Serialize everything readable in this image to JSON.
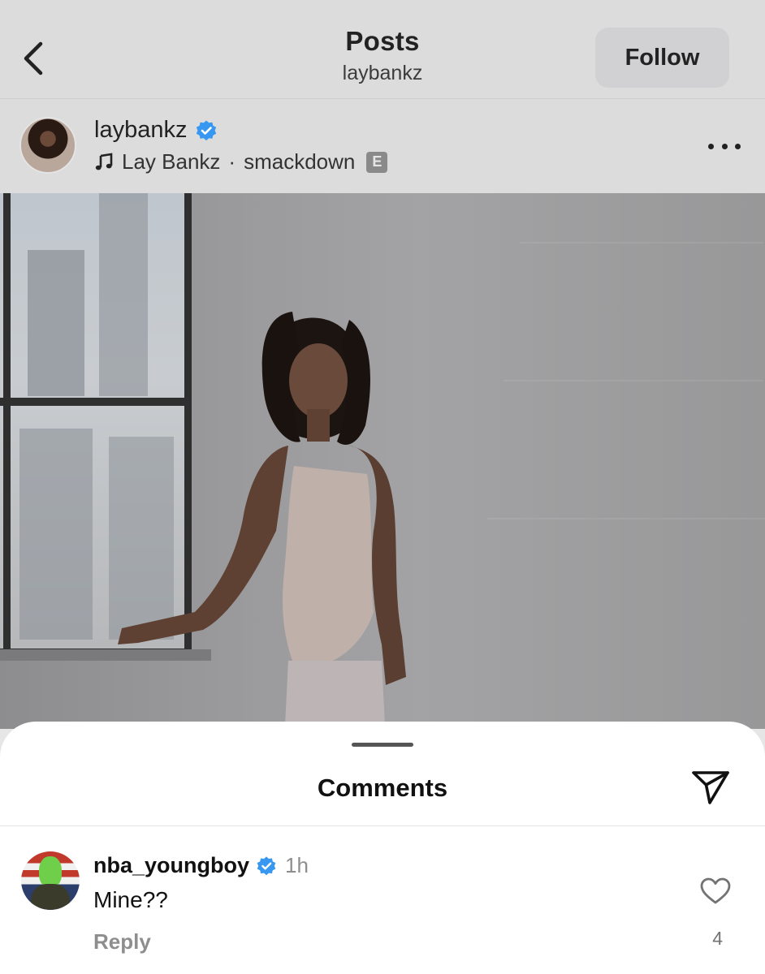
{
  "header": {
    "title": "Posts",
    "subtitle": "laybankz",
    "follow_label": "Follow",
    "back_icon": "chevron-left-icon"
  },
  "post": {
    "username": "laybankz",
    "verified": true,
    "music_artist": "Lay Bankz",
    "music_separator": "·",
    "music_track": "smackdown",
    "explicit_badge": "E",
    "more_icon": "ellipsis-icon"
  },
  "comments_sheet": {
    "title": "Comments",
    "share_icon": "paper-plane-icon",
    "comments": [
      {
        "username": "nba_youngboy",
        "verified": true,
        "time": "1h",
        "text": "Mine??",
        "reply_label": "Reply",
        "like_count": "4"
      }
    ]
  },
  "colors": {
    "verified_blue": "#3897f0",
    "dim_overlay": "#dcdcdd",
    "muted_text": "#8e8e8e"
  }
}
